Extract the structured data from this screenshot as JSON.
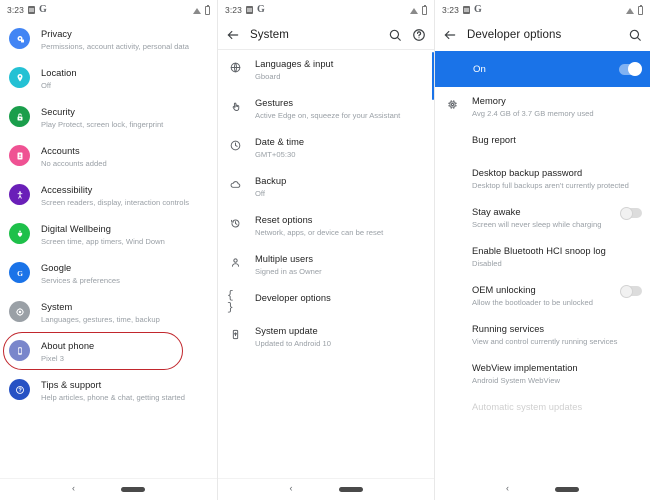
{
  "status_bar": {
    "time": "3:23",
    "icons": [
      "calendar-icon",
      "google-icon",
      "wifi-icon",
      "battery-icon"
    ]
  },
  "colors": {
    "accent_blue": "#1a73e8",
    "highlight_red": "#c1272d",
    "privacy": "#4285f4",
    "location": "#24c1d4",
    "security": "#1a9e4b",
    "accounts": "#ef5293",
    "accessibility": "#6a1fb8",
    "digital_wellbeing": "#1ec04a",
    "google": "#1a73e8",
    "system": "#9aa0a6",
    "about_phone": "#7986cb",
    "tips": "#2752c4"
  },
  "panel1": {
    "name": "settings-main",
    "items": [
      {
        "icon": "privacy-icon",
        "title": "Privacy",
        "subtitle": "Permissions, account activity, personal data"
      },
      {
        "icon": "location-icon",
        "title": "Location",
        "subtitle": "Off"
      },
      {
        "icon": "security-icon",
        "title": "Security",
        "subtitle": "Play Protect, screen lock, fingerprint"
      },
      {
        "icon": "accounts-icon",
        "title": "Accounts",
        "subtitle": "No accounts added"
      },
      {
        "icon": "accessibility-icon",
        "title": "Accessibility",
        "subtitle": "Screen readers, display, interaction controls"
      },
      {
        "icon": "wellbeing-icon",
        "title": "Digital Wellbeing",
        "subtitle": "Screen time, app timers, Wind Down"
      },
      {
        "icon": "google-icon",
        "title": "Google",
        "subtitle": "Services & preferences"
      },
      {
        "icon": "system-icon",
        "title": "System",
        "subtitle": "Languages, gestures, time, backup"
      },
      {
        "icon": "phone-icon",
        "title": "About phone",
        "subtitle": "Pixel 3"
      },
      {
        "icon": "help-icon",
        "title": "Tips & support",
        "subtitle": "Help articles, phone & chat, getting started"
      }
    ]
  },
  "panel2": {
    "name": "system-settings",
    "title": "System",
    "actions": [
      "search-icon",
      "help-icon"
    ],
    "items": [
      {
        "icon": "globe-icon",
        "title": "Languages & input",
        "subtitle": "Gboard"
      },
      {
        "icon": "gesture-icon",
        "title": "Gestures",
        "subtitle": "Active Edge on, squeeze for your Assistant"
      },
      {
        "icon": "clock-icon",
        "title": "Date & time",
        "subtitle": "GMT+05:30"
      },
      {
        "icon": "cloud-icon",
        "title": "Backup",
        "subtitle": "Off"
      },
      {
        "icon": "restore-icon",
        "title": "Reset options",
        "subtitle": "Network, apps, or device can be reset"
      },
      {
        "icon": "person-icon",
        "title": "Multiple users",
        "subtitle": "Signed in as Owner"
      },
      {
        "icon": "braces-icon",
        "title": "Developer options",
        "subtitle": ""
      },
      {
        "icon": "update-icon",
        "title": "System update",
        "subtitle": "Updated to Android 10"
      }
    ]
  },
  "panel3": {
    "name": "developer-options",
    "title": "Developer options",
    "actions": [
      "search-icon"
    ],
    "master_toggle": {
      "label": "On",
      "state": "on"
    },
    "items": [
      {
        "icon": "memory-icon",
        "title": "Memory",
        "subtitle": "Avg 2.4 GB of 3.7 GB memory used",
        "toggle": null
      },
      {
        "icon": "",
        "title": "Bug report",
        "subtitle": "",
        "toggle": null
      },
      {
        "icon": "",
        "title": "Desktop backup password",
        "subtitle": "Desktop full backups aren't currently protected",
        "toggle": null
      },
      {
        "icon": "",
        "title": "Stay awake",
        "subtitle": "Screen will never sleep while charging",
        "toggle": "off"
      },
      {
        "icon": "",
        "title": "Enable Bluetooth HCI snoop log",
        "subtitle": "Disabled",
        "toggle": null
      },
      {
        "icon": "",
        "title": "OEM unlocking",
        "subtitle": "Allow the bootloader to be unlocked",
        "toggle": "off"
      },
      {
        "icon": "",
        "title": "Running services",
        "subtitle": "View and control currently running services",
        "toggle": null
      },
      {
        "icon": "",
        "title": "WebView implementation",
        "subtitle": "Android System WebView",
        "toggle": null
      },
      {
        "icon": "",
        "title": "Automatic system updates",
        "subtitle": "",
        "toggle": null
      }
    ]
  },
  "nav_bar": {
    "back": "‹",
    "home_pill": "home-pill"
  }
}
